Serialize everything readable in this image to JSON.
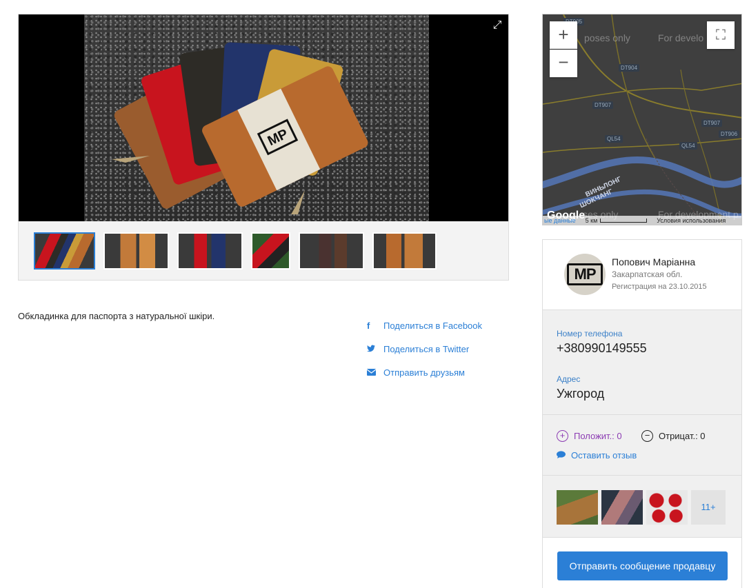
{
  "gallery": {
    "thumbnail_count": 6,
    "active_index": 0
  },
  "description": "Обкладинка для паспорта з натуральної шкіри.",
  "share": {
    "facebook": "Поделиться в Facebook",
    "twitter": "Поделиться в Twitter",
    "email": "Отправить друзьям"
  },
  "map": {
    "watermark_top_left": "poses only",
    "watermark_top_right": "For develo",
    "watermark_bottom_left": "ses only",
    "watermark_bottom_right": "For development p",
    "roads": [
      "DT905",
      "DT904",
      "DT907",
      "DT907",
      "DT907",
      "DT906",
      "QL54",
      "QL54"
    ],
    "river_labels": [
      "ВИНЬЛОНГ",
      "ШОКЧАНГ"
    ],
    "footer_data_link": "ые данные",
    "footer_scale": "5 км",
    "footer_terms": "Условия использования",
    "google": "Google"
  },
  "seller": {
    "avatar_initials": "MP",
    "name": "Попович Маріанна",
    "region": "Закарпатская обл.",
    "registered": "Регистрация на 23.10.2015"
  },
  "contacts": {
    "phone_label": "Номер телефона",
    "phone": "+380990149555",
    "address_label": "Адрес",
    "address": "Ужгород"
  },
  "reviews": {
    "positive": "Положит.: 0",
    "negative": "Отрицат.: 0",
    "leave": "Оставить отзыв"
  },
  "other_ads": {
    "more": "11+"
  },
  "contact_button": "Отправить сообщение продавцу",
  "colors": {
    "accent": "#2b7fd6",
    "positive": "#8c3cb3"
  }
}
